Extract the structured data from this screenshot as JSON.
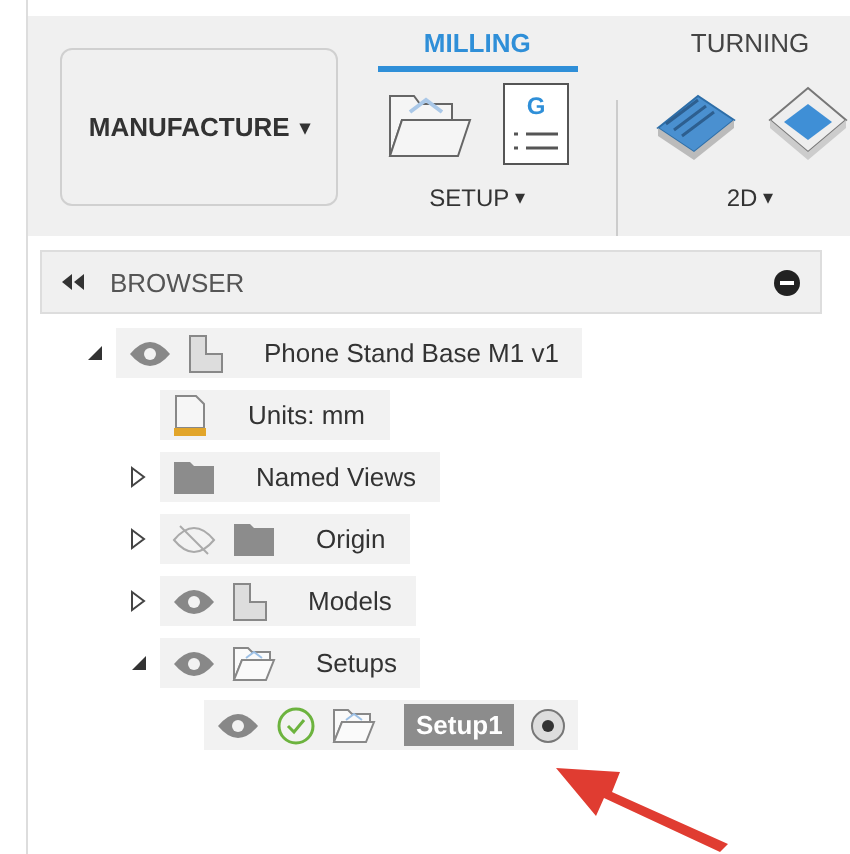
{
  "workspace": {
    "label": "MANUFACTURE",
    "caret": "▾"
  },
  "tabs": [
    {
      "label": "MILLING",
      "selected": true
    },
    {
      "label": "TURNING",
      "selected": false
    }
  ],
  "tool_groups": [
    {
      "label": "SETUP",
      "caret": "▾",
      "tools": [
        {
          "kind": "folder"
        },
        {
          "kind": "gcode",
          "glyph": "G"
        }
      ]
    },
    {
      "label": "2D",
      "caret": "▾",
      "tools": [
        {
          "kind": "adaptive"
        },
        {
          "kind": "pocket"
        }
      ]
    }
  ],
  "browser": {
    "title": "BROWSER",
    "tree": [
      {
        "label": "Phone Stand Base M1 v1",
        "kind": "component",
        "visible": true,
        "expanded": true,
        "selected": false,
        "children": [
          {
            "label": "Units: mm",
            "kind": "units",
            "selected": false
          },
          {
            "label": "Named Views",
            "kind": "folder",
            "expanded": false,
            "selected": false
          },
          {
            "label": "Origin",
            "kind": "folder",
            "visible": false,
            "expanded": false,
            "selected": false
          },
          {
            "label": "Models",
            "kind": "component",
            "visible": true,
            "expanded": false,
            "selected": false
          },
          {
            "label": "Setups",
            "kind": "open-folder",
            "visible": true,
            "expanded": true,
            "selected": false,
            "children": [
              {
                "label": "Setup1",
                "kind": "open-folder",
                "visible": true,
                "valid": true,
                "active": true,
                "selected": true
              }
            ]
          }
        ]
      }
    ]
  }
}
